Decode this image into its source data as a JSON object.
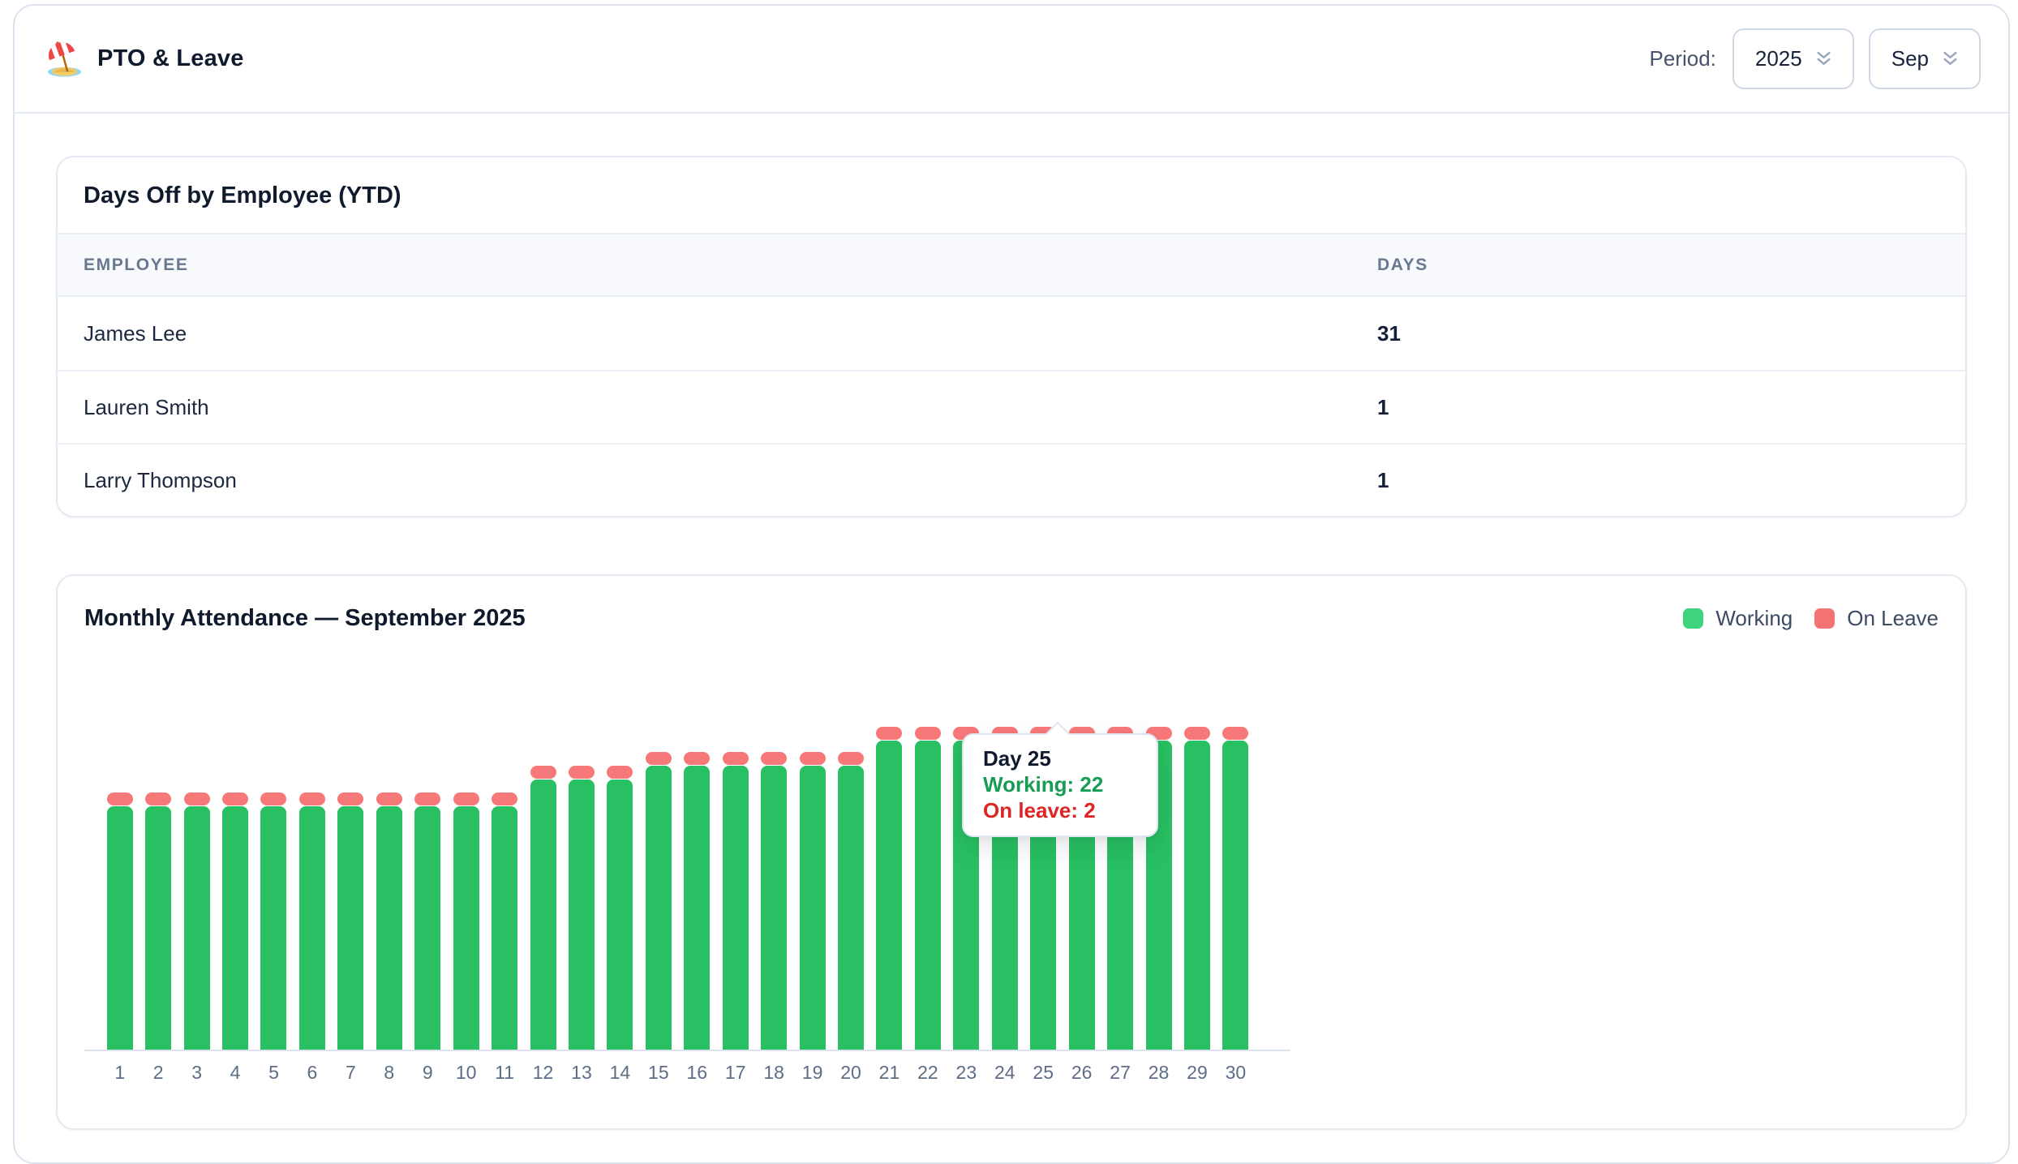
{
  "header": {
    "icon": "beach-umbrella-icon",
    "title": "PTO & Leave",
    "period_label": "Period:",
    "year_value": "2025",
    "month_value": "Sep",
    "select_icon": "chevrons-down-icon"
  },
  "days_off_card": {
    "title": "Days Off by Employee (YTD)",
    "col_employee": "EMPLOYEE",
    "col_days": "DAYS",
    "rows": [
      {
        "employee": "James Lee",
        "days": "31"
      },
      {
        "employee": "Lauren Smith",
        "days": "1"
      },
      {
        "employee": "Larry Thompson",
        "days": "1"
      }
    ]
  },
  "attendance_card": {
    "title": "Monthly Attendance — September 2025",
    "legend": [
      {
        "label": "Working",
        "color": "#3ED47D"
      },
      {
        "label": "On Leave",
        "color": "#F47373"
      }
    ],
    "tooltip": {
      "title": "Day 25",
      "working": "Working: 22",
      "on_leave": "On leave: 2"
    }
  },
  "chart_data": {
    "type": "bar",
    "stacked": true,
    "title": "Monthly Attendance — September 2025",
    "categories": [
      1,
      2,
      3,
      4,
      5,
      6,
      7,
      8,
      9,
      10,
      11,
      12,
      13,
      14,
      15,
      16,
      17,
      18,
      19,
      20,
      21,
      22,
      23,
      24,
      25,
      26,
      27,
      28,
      29,
      30
    ],
    "series": [
      {
        "name": "Working",
        "color": "#28C062",
        "values": [
          18,
          18,
          18,
          18,
          18,
          18,
          18,
          18,
          18,
          18,
          18,
          20,
          20,
          20,
          21,
          21,
          21,
          21,
          21,
          21,
          23,
          23,
          23,
          23,
          22,
          23,
          23,
          23,
          23,
          23
        ]
      },
      {
        "name": "On Leave",
        "color": "#F77878",
        "values": [
          1,
          1,
          1,
          1,
          1,
          1,
          1,
          1,
          1,
          1,
          1,
          1,
          1,
          1,
          1,
          1,
          1,
          1,
          1,
          1,
          1,
          1,
          1,
          1,
          2,
          1,
          1,
          1,
          1,
          1
        ]
      }
    ],
    "xlabel": "",
    "ylabel": "",
    "ylim": [
      0,
      24
    ],
    "grid": false,
    "legend_position": "top-right",
    "highlighted_day": 25
  }
}
